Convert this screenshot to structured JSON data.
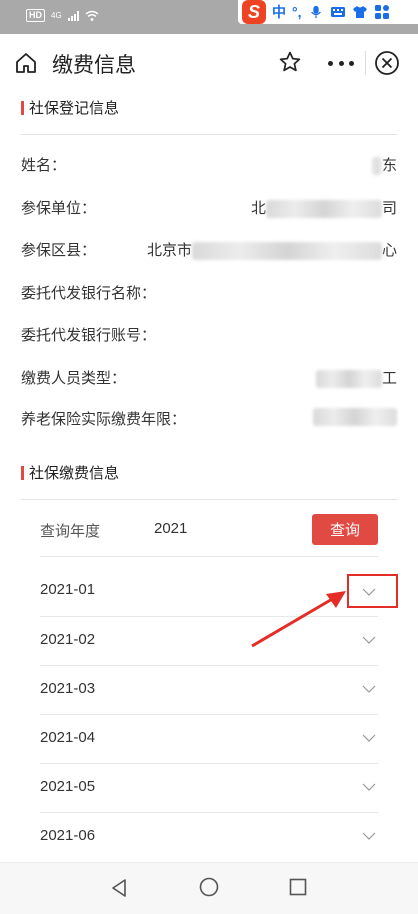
{
  "status_bar": {
    "hd_label": "HD",
    "network_label": "4G",
    "ime": {
      "logo": "S",
      "items": [
        "中",
        "°,"
      ]
    }
  },
  "header": {
    "title": "缴费信息",
    "icons": [
      "home-icon",
      "star-icon",
      "more-icon",
      "close-icon"
    ]
  },
  "registration": {
    "section_title": "社保登记信息",
    "rows": [
      {
        "label": "姓名：",
        "value_prefix": "",
        "value_suffix": "东"
      },
      {
        "label": "参保单位：",
        "value_prefix": "北",
        "value_suffix": "司"
      },
      {
        "label": "参保区县：",
        "value_prefix": "北京市",
        "value_suffix": "心"
      },
      {
        "label": "委托代发银行名称：",
        "value_prefix": "",
        "value_suffix": ""
      },
      {
        "label": "委托代发银行账号：",
        "value_prefix": "",
        "value_suffix": ""
      },
      {
        "label": "缴费人员类型：",
        "value_prefix": "",
        "value_suffix": "工"
      },
      {
        "label": "养老保险实际缴费年限：",
        "value_prefix": "",
        "value_suffix": ""
      }
    ]
  },
  "payment": {
    "section_title": "社保缴费信息",
    "query_label": "查询年度",
    "query_year": "2021",
    "query_button": "查询",
    "months": [
      "2021-01",
      "2021-02",
      "2021-03",
      "2021-04",
      "2021-05",
      "2021-06"
    ]
  },
  "colors": {
    "accent": "#e14a42",
    "annotation": "#e52d27",
    "status_bar": "#a9a9a9"
  }
}
